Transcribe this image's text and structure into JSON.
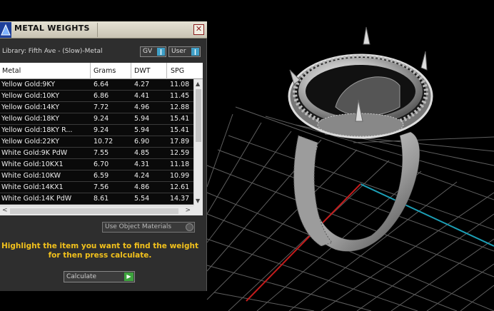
{
  "panel": {
    "title": "METAL WEIGHTS",
    "close_glyph": "✕",
    "library_label": "Library: Fifth Ave - (Slow)-Metal",
    "toggle_gv": "GV",
    "toggle_user": "User",
    "columns": [
      "Metal",
      "Grams",
      "DWT",
      "SPG"
    ],
    "rows": [
      [
        "Yellow Gold:9KY",
        "6.64",
        "4.27",
        "11.08"
      ],
      [
        "Yellow Gold:10KY",
        "6.86",
        "4.41",
        "11.45"
      ],
      [
        "Yellow Gold:14KY",
        "7.72",
        "4.96",
        "12.88"
      ],
      [
        "Yellow Gold:18KY",
        "9.24",
        "5.94",
        "15.41"
      ],
      [
        "Yellow Gold:18KY R...",
        "9.24",
        "5.94",
        "15.41"
      ],
      [
        "Yellow Gold:22KY",
        "10.72",
        "6.90",
        "17.89"
      ],
      [
        "White Gold:9K PdW",
        "7.55",
        "4.85",
        "12.59"
      ],
      [
        "White Gold:10KX1",
        "6.70",
        "4.31",
        "11.18"
      ],
      [
        "White Gold:10KW",
        "6.59",
        "4.24",
        "10.99"
      ],
      [
        "White Gold:14KX1",
        "7.56",
        "4.86",
        "12.61"
      ],
      [
        "White Gold:14K PdW",
        "8.61",
        "5.54",
        "14.37"
      ]
    ],
    "use_object_materials": "Use Object Materials",
    "hint_line1": "Highlight the item you want to find the weight",
    "hint_line2": "for then press calculate.",
    "calculate_label": "Calculate"
  },
  "icons": {
    "logo": "jewelry-cad-logo-icon",
    "close": "close-icon",
    "run": "play-arrow-icon"
  },
  "colors": {
    "hint": "#f2c11c",
    "toggle_knob": "#3fa0c8",
    "run_button": "#3da33d",
    "grid_axis_red": "#c21c1c",
    "grid_axis_cyan": "#1c9fb6"
  }
}
